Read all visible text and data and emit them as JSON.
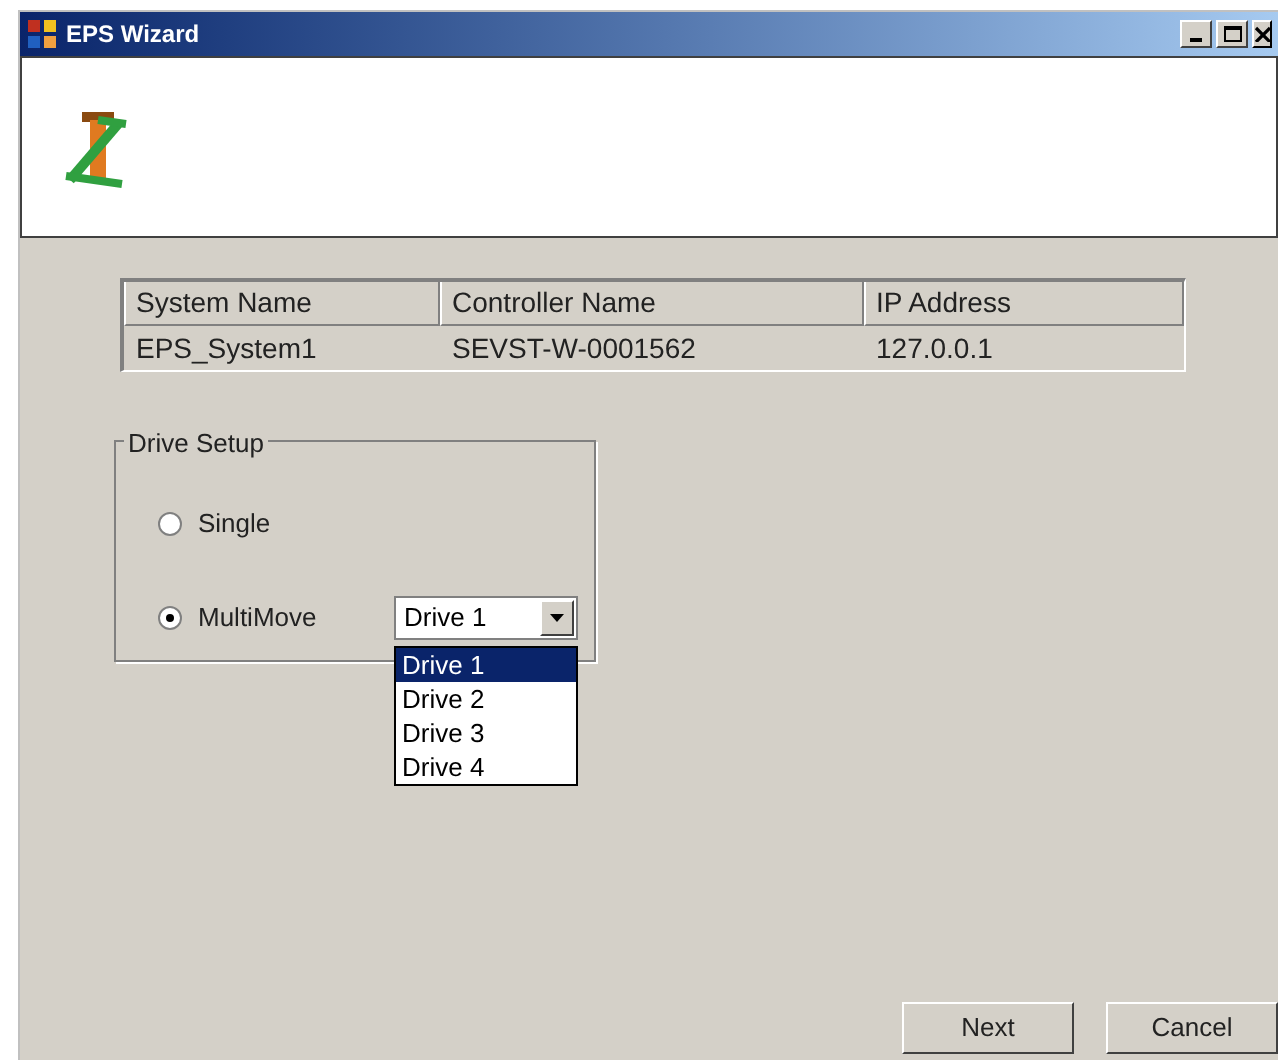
{
  "window": {
    "title": "EPS Wizard"
  },
  "table": {
    "columns": [
      "System Name",
      "Controller Name",
      "IP Address"
    ],
    "rows": [
      [
        "EPS_System1",
        "SEVST-W-0001562",
        "127.0.0.1"
      ]
    ]
  },
  "drive_setup": {
    "title": "Drive Setup",
    "options": [
      {
        "label": "Single",
        "selected": false
      },
      {
        "label": "MultiMove",
        "selected": true
      }
    ],
    "combo": {
      "value": "Drive 1",
      "expanded": true,
      "items": [
        {
          "label": "Drive 1",
          "selected": true
        },
        {
          "label": "Drive 2",
          "selected": false
        },
        {
          "label": "Drive 3",
          "selected": false
        },
        {
          "label": "Drive 4",
          "selected": false
        }
      ]
    }
  },
  "buttons": [
    "Next",
    "Cancel"
  ]
}
